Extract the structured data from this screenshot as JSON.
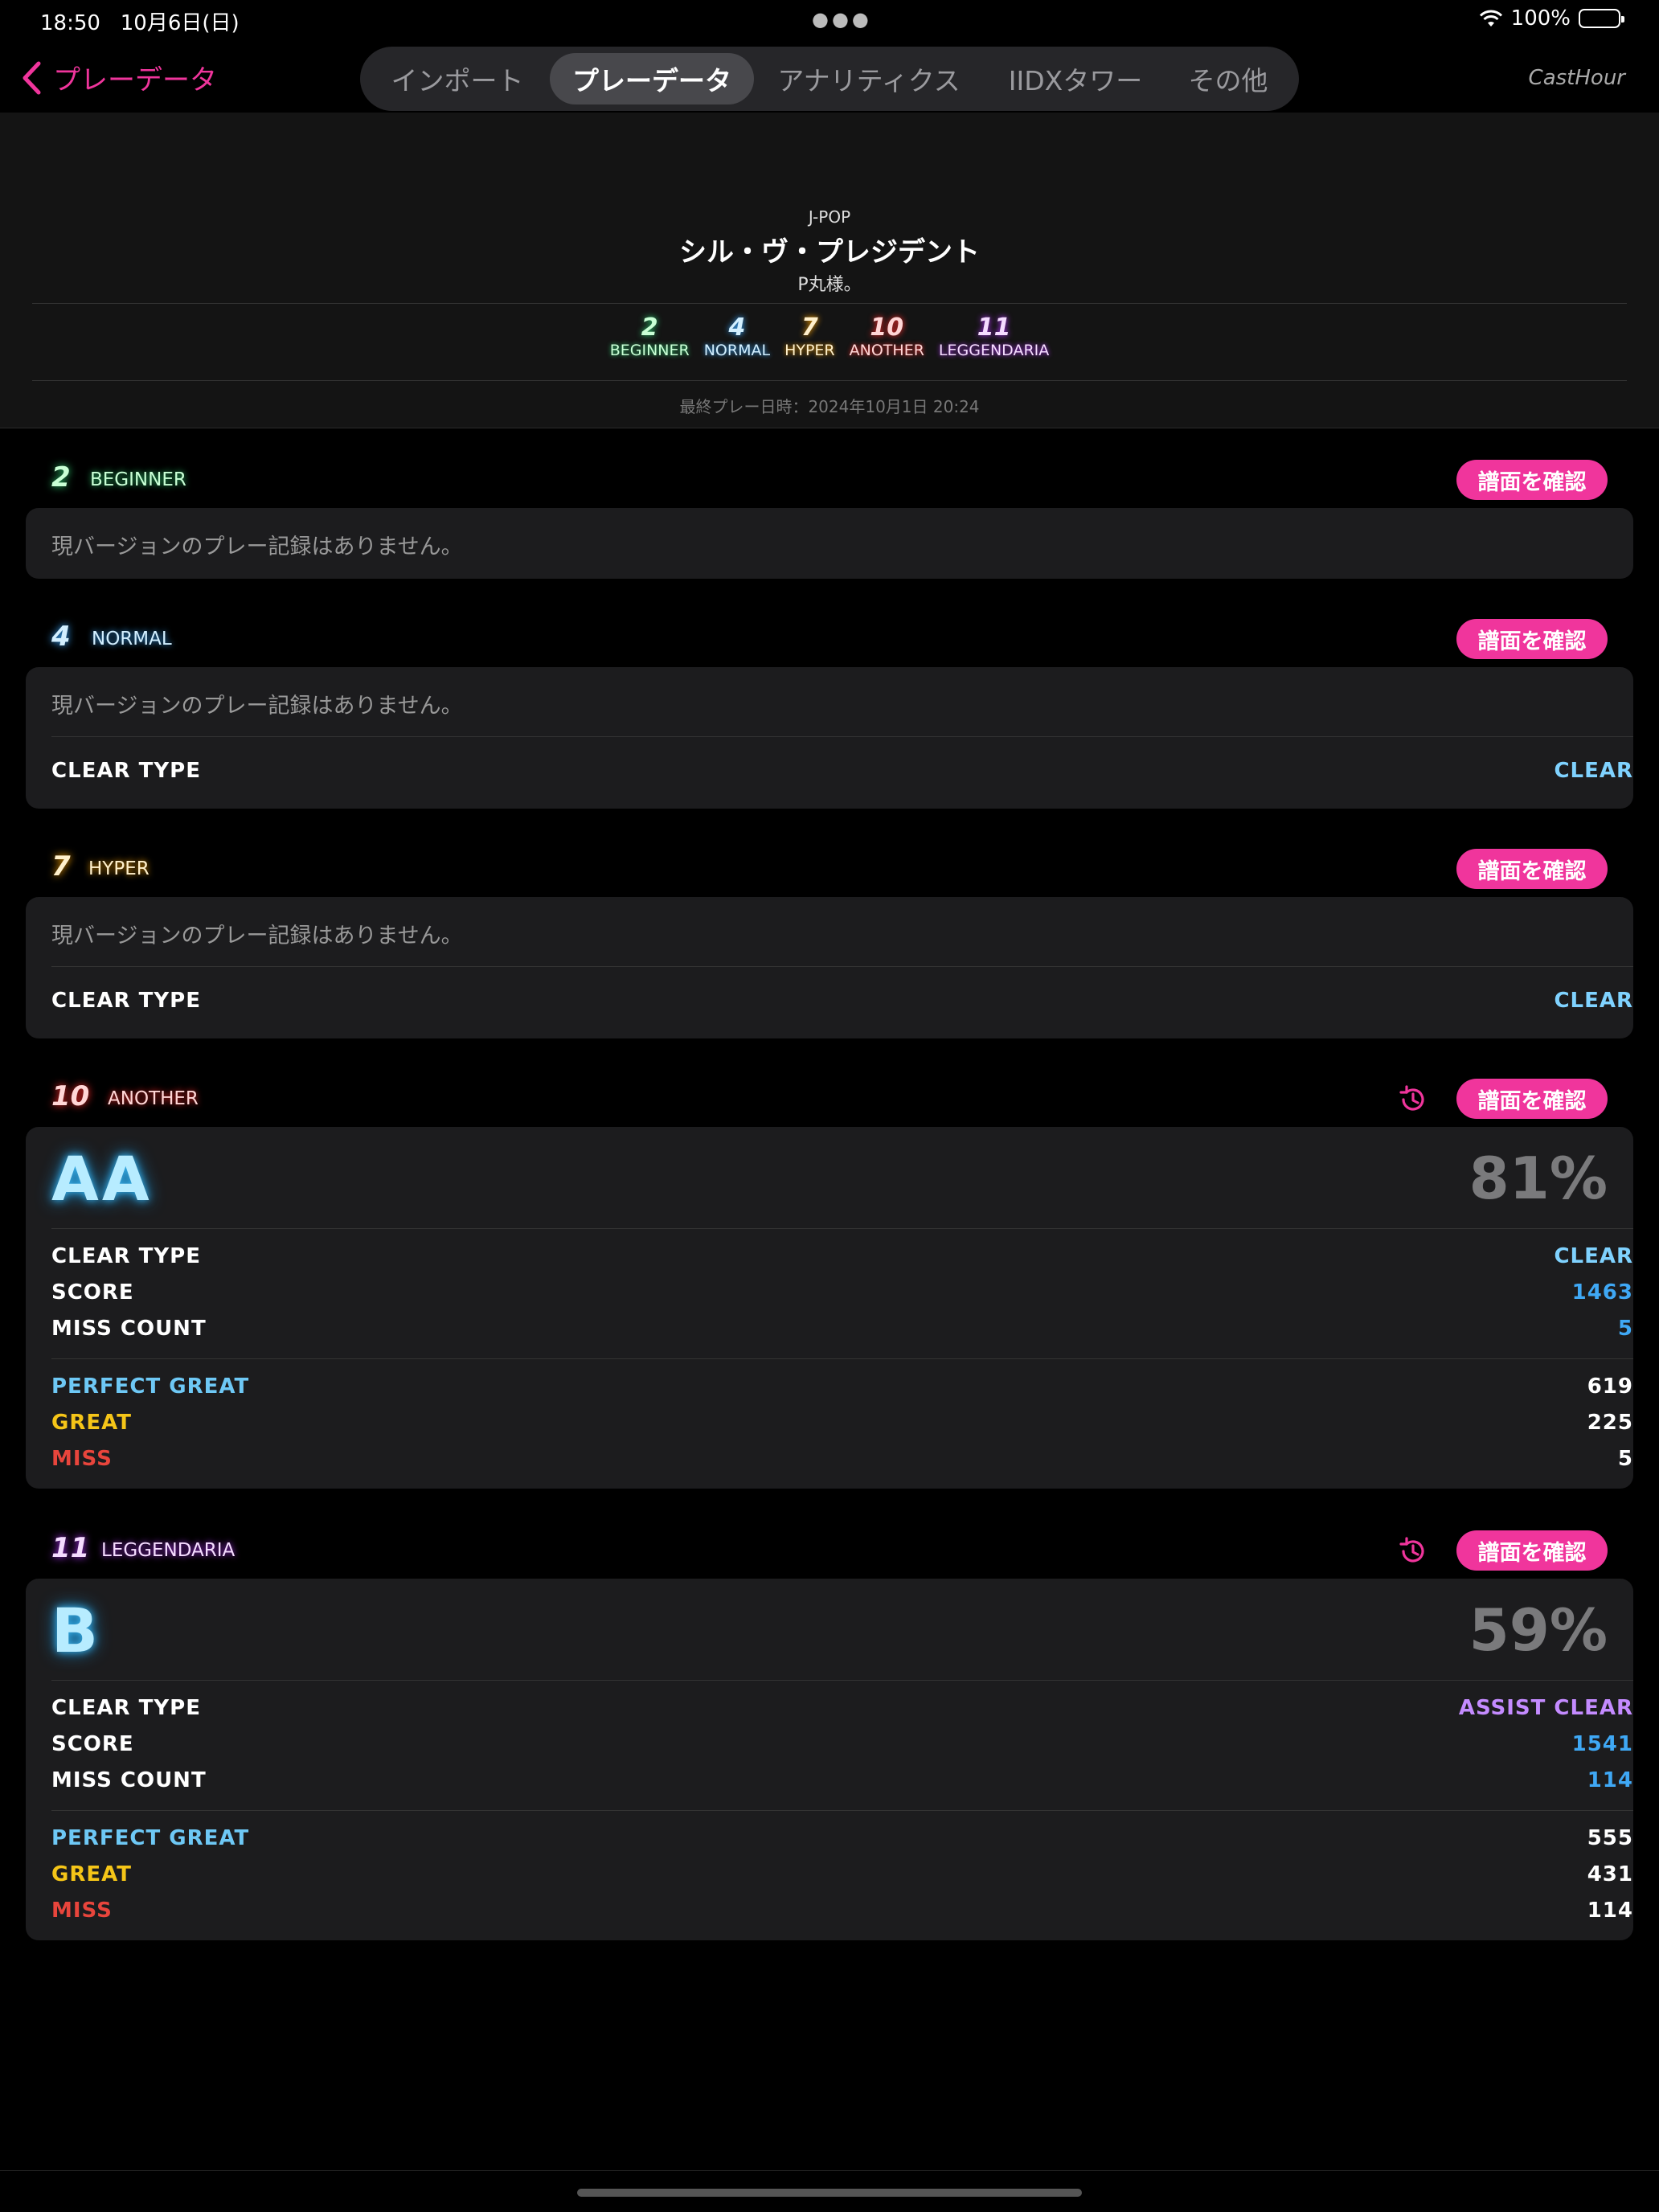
{
  "status": {
    "time": "18:50",
    "date": "10月6日(日)",
    "battery": "100%"
  },
  "nav": {
    "back_label": "プレーデータ",
    "tabs": [
      "インポート",
      "プレーデータ",
      "アナリティクス",
      "IIDXタワー",
      "その他"
    ],
    "active_tab": 1,
    "right_label": "CastHour"
  },
  "song": {
    "genre": "J-POP",
    "title": "シル・ヴ・プレジデント",
    "artist": "P丸様。",
    "levels": [
      {
        "num": "2",
        "name": "BEGINNER"
      },
      {
        "num": "4",
        "name": "NORMAL"
      },
      {
        "num": "7",
        "name": "HYPER"
      },
      {
        "num": "10",
        "name": "ANOTHER"
      },
      {
        "num": "11",
        "name": "LEGGENDARIA"
      }
    ],
    "last_play": "最終プレー日時：2024年10月1日 20:24"
  },
  "confirm_label": "譜面を確認",
  "no_record": "現バージョンのプレー記録はありません。",
  "labels": {
    "clear_type": "CLEAR TYPE",
    "score": "SCORE",
    "miss_count": "MISS COUNT",
    "perfect_great": "PERFECT GREAT",
    "great": "GREAT",
    "miss": "MISS"
  },
  "charts": {
    "beginner": {
      "num": "2",
      "name": "BEGINNER"
    },
    "normal": {
      "num": "4",
      "name": "NORMAL",
      "clear_type": "CLEAR"
    },
    "hyper": {
      "num": "7",
      "name": "HYPER",
      "clear_type": "CLEAR"
    },
    "another": {
      "num": "10",
      "name": "ANOTHER",
      "grade": "AA",
      "percent": "81%",
      "clear_type": "CLEAR",
      "score": "1463",
      "miss_count": "5",
      "perfect_great": "619",
      "great": "225",
      "miss": "5"
    },
    "leggendaria": {
      "num": "11",
      "name": "LEGGENDARIA",
      "grade": "B",
      "percent": "59%",
      "clear_type": "ASSIST CLEAR",
      "score": "1541",
      "miss_count": "114",
      "perfect_great": "555",
      "great": "431",
      "miss": "114"
    }
  },
  "colors": {
    "accent": "#f0359c",
    "beginner": "#7ff59a",
    "normal": "#8ed8ff",
    "hyper": "#ffd27a",
    "another": "#ff8a8a",
    "leggendaria": "#e9a7ff",
    "clear": "#7fd2ff",
    "assist_clear": "#c48bff",
    "score_blue": "#3fa8f5",
    "pgreat": "#6ec8f5",
    "great": "#f5c518",
    "miss": "#e8453c"
  }
}
